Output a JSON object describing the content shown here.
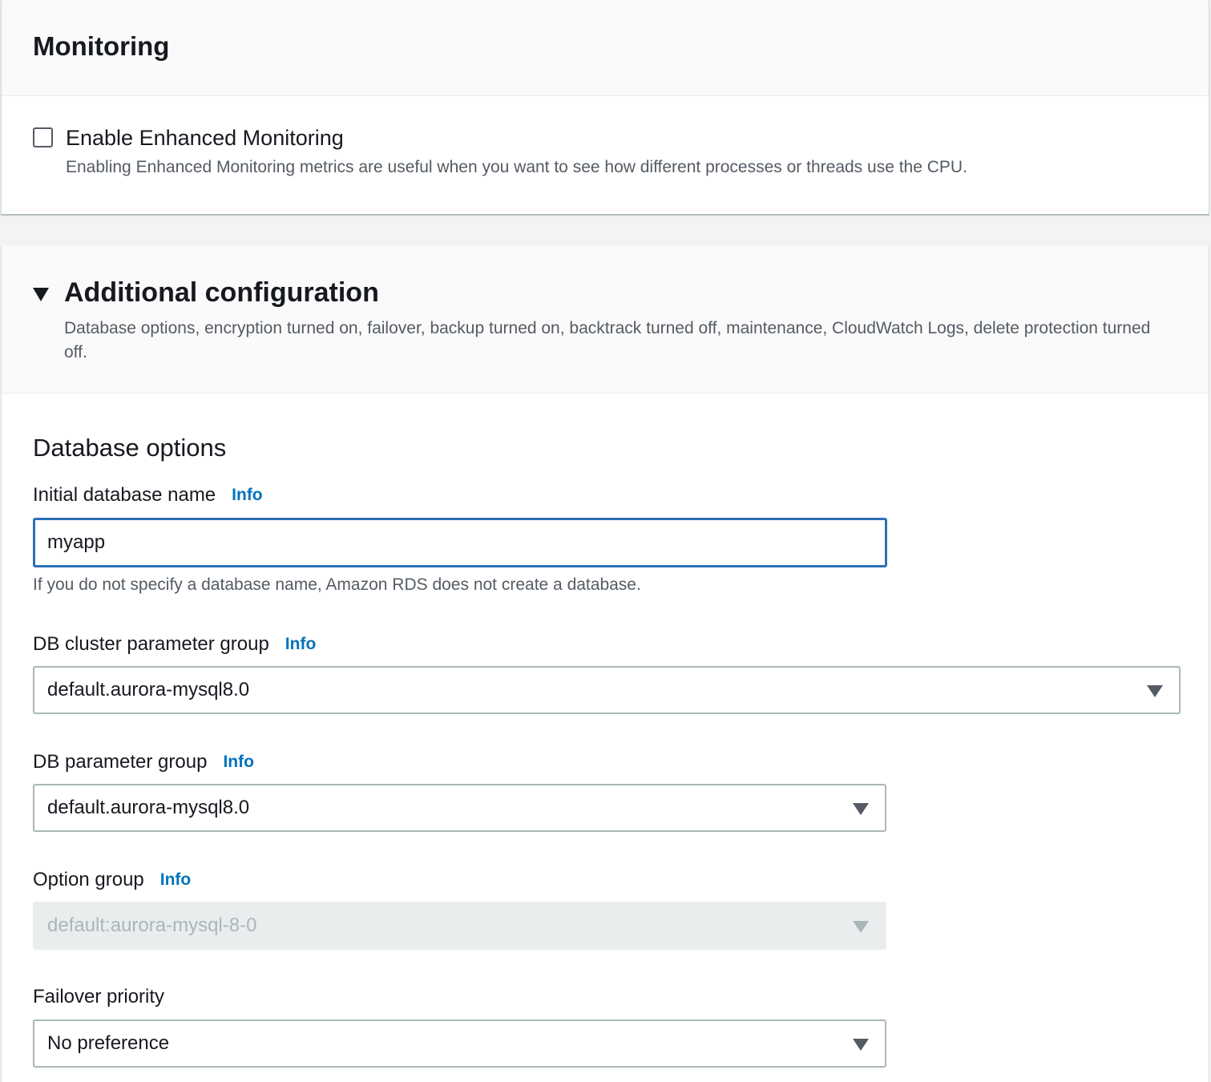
{
  "monitoring": {
    "title": "Monitoring",
    "enhanced_label": "Enable Enhanced Monitoring",
    "enhanced_desc": "Enabling Enhanced Monitoring metrics are useful when you want to see how different processes or threads use the CPU.",
    "enhanced_checked": false
  },
  "additional": {
    "title": "Additional configuration",
    "description": "Database options, encryption turned on, failover, backup turned on, backtrack turned off, maintenance, CloudWatch Logs, delete protection turned off.",
    "expanded": true
  },
  "database_options": {
    "section_title": "Database options",
    "initial_db_name": {
      "label": "Initial database name",
      "info": "Info",
      "value": "myapp",
      "hint": "If you do not specify a database name, Amazon RDS does not create a database."
    },
    "cluster_param_group": {
      "label": "DB cluster parameter group",
      "info": "Info",
      "value": "default.aurora-mysql8.0"
    },
    "db_param_group": {
      "label": "DB parameter group",
      "info": "Info",
      "value": "default.aurora-mysql8.0"
    },
    "option_group": {
      "label": "Option group",
      "info": "Info",
      "value": "default:aurora-mysql-8-0",
      "disabled": true
    },
    "failover_priority": {
      "label": "Failover priority",
      "value": "No preference"
    }
  },
  "colors": {
    "link": "#0073bb",
    "focus_border": "#2e6fb7",
    "text": "#16191f",
    "secondary_text": "#545b64",
    "disabled_bg": "#eaeded",
    "disabled_text": "#aab7b8",
    "page_bg": "#f2f3f3"
  },
  "icons": {
    "expand": "caret-down-icon",
    "select": "triangle-down-icon"
  }
}
